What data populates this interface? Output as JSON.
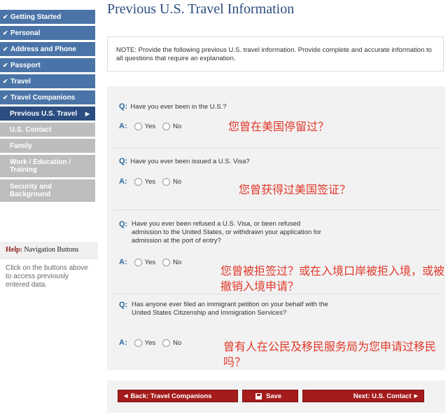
{
  "sidebar": {
    "items": [
      {
        "label": "Getting Started",
        "state": "done"
      },
      {
        "label": "Personal",
        "state": "done"
      },
      {
        "label": "Address and Phone",
        "state": "done"
      },
      {
        "label": "Passport",
        "state": "done"
      },
      {
        "label": "Travel",
        "state": "done"
      },
      {
        "label": "Travel Companions",
        "state": "done"
      },
      {
        "label": "Previous U.S. Travel",
        "state": "current"
      },
      {
        "label": "U.S. Contact",
        "state": "pending"
      },
      {
        "label": "Family",
        "state": "pending"
      },
      {
        "label": "Work / Education / Training",
        "state": "pending"
      },
      {
        "label": "Security and Background",
        "state": "pending"
      }
    ]
  },
  "help": {
    "title_bold": "Help:",
    "title_rest": "Navigation Buttons",
    "text": "Click on the buttons above to access previously entered data."
  },
  "page": {
    "title": "Previous U.S. Travel Information",
    "note": "NOTE: Provide the following previous U.S. travel information. Provide complete and accurate information to all questions that require an explanation."
  },
  "labels": {
    "q": "Q:",
    "a": "A:",
    "yes": "Yes",
    "no": "No"
  },
  "questions": [
    {
      "text": "Have you ever been in the U.S.?",
      "annotation": "您曾在美国停留过？"
    },
    {
      "text": "Have you ever been issued a U.S. Visa?",
      "annotation": "您曾获得过美国签证？"
    },
    {
      "text": "Have you ever been refused a U.S. Visa, or been refused admission to the United States, or withdrawn your application for admission at the port of entry?",
      "annotation": "您曾被拒签过？或在入境口岸被拒入境，或被撤销入境申请？"
    },
    {
      "text": "Has anyone ever filed an immigrant petition on your behalf with the United States Citizenship and Immigration Services?",
      "annotation": "曾有人在公民及移民服务局为您申请过移民吗？"
    }
  ],
  "buttons": {
    "back": "Back: Travel Companions",
    "save": "Save",
    "next": "Next: U.S. Contact"
  },
  "colors": {
    "nav_done": "#4a74a8",
    "nav_current": "#2b4d80",
    "nav_pending": "#bdbdbd",
    "button": "#a51c1c",
    "annotation": "#e0392b"
  }
}
